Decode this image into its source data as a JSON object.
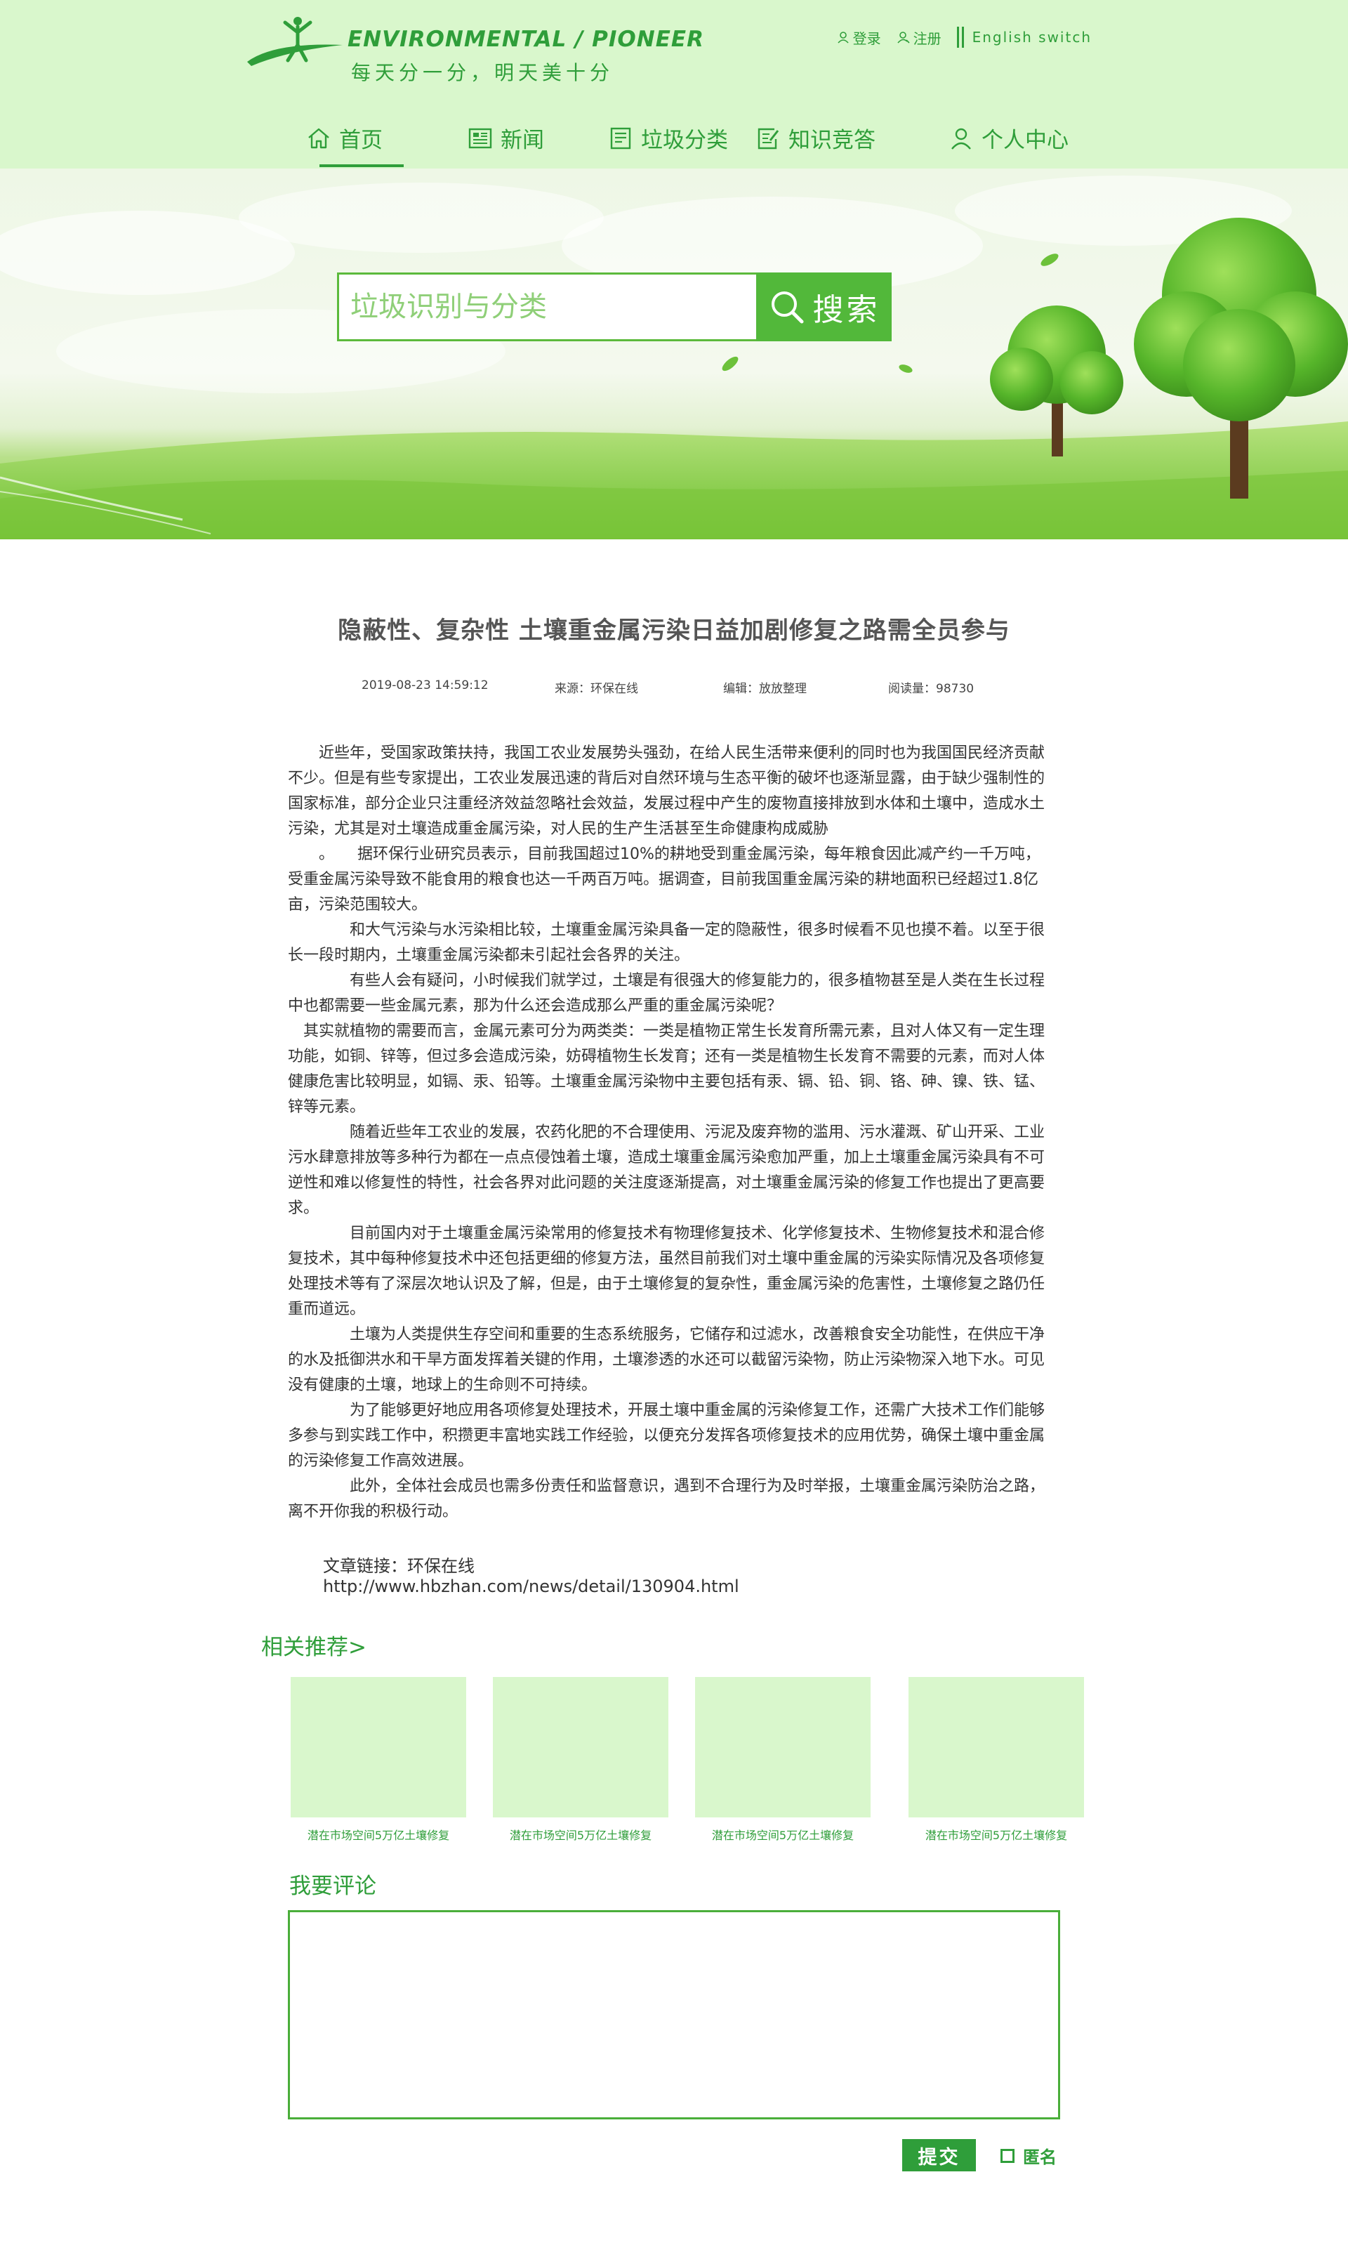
{
  "brand": {
    "name_en": "ENVIRONMENTAL / PIONEER",
    "slogan": "每天分一分，明天美十分",
    "color": "#2f9e3a",
    "light_color": "#d9f7cc"
  },
  "top_links": {
    "login": "登录",
    "register": "注册",
    "english": "English switch"
  },
  "nav": [
    {
      "label": "首页",
      "icon": "home-icon",
      "active": true
    },
    {
      "label": "新闻",
      "icon": "newspaper-icon",
      "active": false
    },
    {
      "label": "垃圾分类",
      "icon": "list-icon",
      "active": false
    },
    {
      "label": "知识竞答",
      "icon": "edit-icon",
      "active": false
    },
    {
      "label": "个人中心",
      "icon": "user-icon",
      "active": false
    }
  ],
  "search": {
    "placeholder": "垃圾识别与分类",
    "button": "搜索"
  },
  "article": {
    "title": "隐蔽性、复杂性 土壤重金属污染日益加剧修复之路需全员参与",
    "date": "2019-08-23 14:59:12",
    "source": "来源：环保在线",
    "editor": "编辑：放放整理",
    "reads": "阅读量：98730",
    "paragraphs": [
      "　　近些年，受国家政策扶持，我国工农业发展势头强劲，在给人民生活带来便利的同时也为我国国民经济贡献不少。但是有些专家提出，工农业发展迅速的背后对自然环境与生态平衡的破坏也逐渐显露，由于缺少强制性的国家标准，部分企业只注重经济效益忽略社会效益，发展过程中产生的废物直接排放到水体和土壤中，造成水土污染，尤其是对土壤造成重金属污染，对人民的生产生活甚至生命健康构成威胁",
      "　　。　　据环保行业研究员表示，目前我国超过10%的耕地受到重金属污染，每年粮食因此减产约一千万吨，受重金属污染导致不能食用的粮食也达一千两百万吨。据调查，目前我国重金属污染的耕地面积已经超过1.8亿亩，污染范围较大。",
      "　　　　和大气污染与水污染相比较，土壤重金属污染具备一定的隐蔽性，很多时候看不见也摸不着。以至于很长一段时期内，土壤重金属污染都未引起社会各界的关注。",
      "　　　　有些人会有疑问，小时候我们就学过，土壤是有很强大的修复能力的，很多植物甚至是人类在生长过程中也都需要一些金属元素，那为什么还会造成那么严重的重金属污染呢？",
      "　其实就植物的需要而言，金属元素可分为两类类：一类是植物正常生长发育所需元素，且对人体又有一定生理功能，如铜、锌等，但过多会造成污染，妨碍植物生长发育；还有一类是植物生长发育不需要的元素，而对人体健康危害比较明显，如镉、汞、铅等。土壤重金属污染物中主要包括有汞、镉、铅、铜、铬、砷、镍、铁、锰、锌等元素。",
      "　　　　随着近些年工农业的发展，农药化肥的不合理使用、污泥及废弃物的滥用、污水灌溉、矿山开采、工业污水肆意排放等多种行为都在一点点侵蚀着土壤，造成土壤重金属污染愈加严重，加上土壤重金属污染具有不可逆性和难以修复性的特性，社会各界对此问题的关注度逐渐提高，对土壤重金属污染的修复工作也提出了更高要求。",
      "　　　　目前国内对于土壤重金属污染常用的修复技术有物理修复技术、化学修复技术、生物修复技术和混合修复技术，其中每种修复技术中还包括更细的修复方法，虽然目前我们对土壤中重金属的污染实际情况及各项修复处理技术等有了深层次地认识及了解，但是，由于土壤修复的复杂性，重金属污染的危害性，土壤修复之路仍任重而道远。",
      "　　　　土壤为人类提供生存空间和重要的生态系统服务，它储存和过滤水，改善粮食安全功能性，在供应干净的水及抵御洪水和干旱方面发挥着关键的作用，土壤渗透的水还可以截留污染物，防止污染物深入地下水。可见没有健康的土壤，地球上的生命则不可持续。",
      "　　　　为了能够更好地应用各项修复处理技术，开展土壤中重金属的污染修复工作，还需广大技术工作们能够多参与到实践工作中，积攒更丰富地实践工作经验，以便充分发挥各项修复技术的应用优势，确保土壤中重金属的污染修复工作高效进展。",
      "　　　　此外，全体社会成员也需多份责任和监督意识，遇到不合理行为及时举报，土壤重金属污染防治之路，离不开你我的积极行动。"
    ],
    "link_label": "文章链接：环保在线",
    "link_url": "http://www.hbzhan.com/news/detail/130904.html"
  },
  "related": {
    "title": "相关推荐>",
    "items": [
      {
        "caption": "潜在市场空间5万亿土壤修复"
      },
      {
        "caption": "潜在市场空间5万亿土壤修复"
      },
      {
        "caption": "潜在市场空间5万亿土壤修复"
      },
      {
        "caption": "潜在市场空间5万亿土壤修复"
      }
    ]
  },
  "comment": {
    "title": "我要评论",
    "value": "",
    "submit": "提交",
    "anonymous": "匿名"
  }
}
